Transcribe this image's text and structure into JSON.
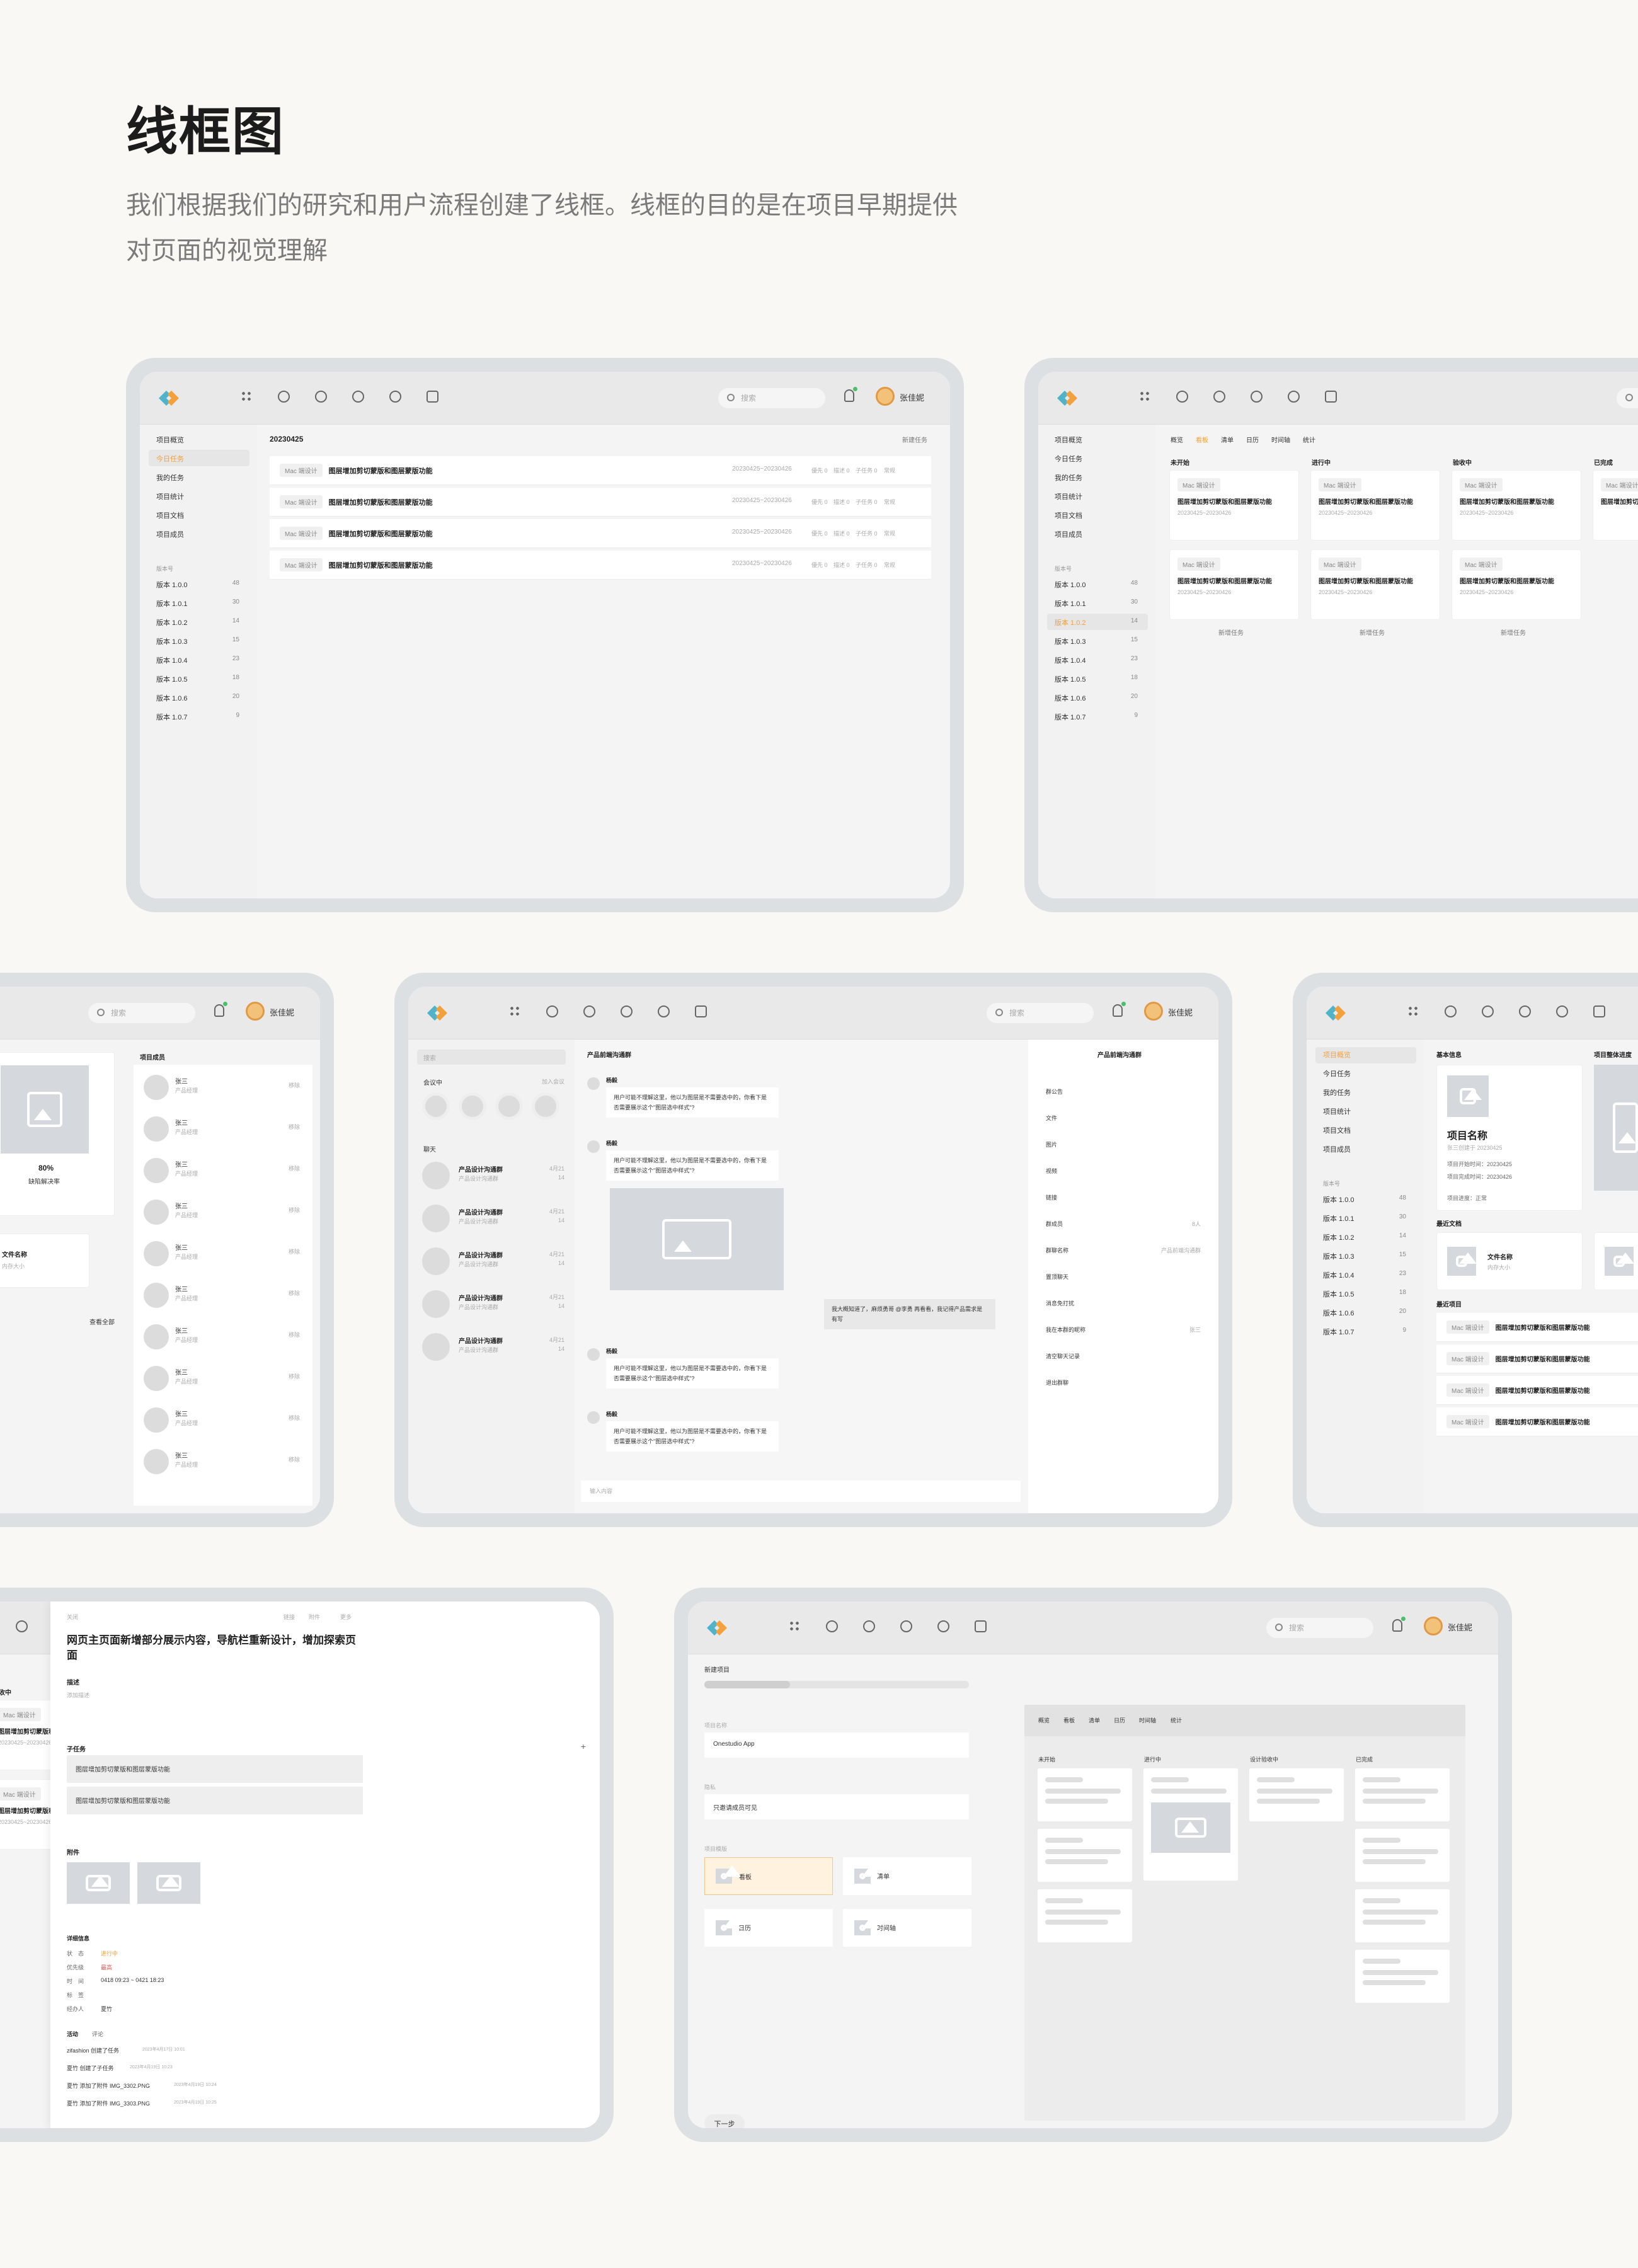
{
  "page": {
    "title": "线框图",
    "subtitle": "我们根据我们的研究和用户流程创建了线框。线框的目的是在项目早期提供对页面的视觉理解"
  },
  "common": {
    "search_placeholder": "搜索",
    "user_name": "张佳妮"
  },
  "nav": [
    "项目概览",
    "今日任务",
    "我的任务",
    "项目统计",
    "项目文档",
    "项目成员"
  ],
  "versions_label": "版本号",
  "versions": [
    {
      "name": "版本 1.0.0",
      "count": "48"
    },
    {
      "name": "版本 1.0.1",
      "count": "30"
    },
    {
      "name": "版本 1.0.2",
      "count": "14"
    },
    {
      "name": "版本 1.0.3",
      "count": "15"
    },
    {
      "name": "版本 1.0.4",
      "count": "23"
    },
    {
      "name": "版本 1.0.5",
      "count": "18"
    },
    {
      "name": "版本 1.0.6",
      "count": "20"
    },
    {
      "name": "版本 1.0.7",
      "count": "9"
    }
  ],
  "task": {
    "tag": "Mac 端设计",
    "title": "图层增加剪切蒙版和图层蒙版功能",
    "date": "20230425~20230426",
    "meta": [
      "優先 0",
      "描述 0",
      "子任务 0",
      "常规"
    ]
  },
  "screen1": {
    "date": "20230425",
    "new_task": "新建任务"
  },
  "screen2": {
    "tabs": [
      "概览",
      "看板",
      "清单",
      "日历",
      "时间轴",
      "统计"
    ],
    "columns": [
      "未开始",
      "进行中",
      "验收中",
      "已完成"
    ],
    "add": "新增任务",
    "task_date": "20230425~20230426",
    "meta": [
      "常规",
      "描述 0",
      "描述 0",
      "子任务 0"
    ]
  },
  "screen3": {
    "members_title": "项目成员",
    "member_name": "张三",
    "member_role": "产品经理",
    "member_action": "移除",
    "progress": "80%",
    "progress_label": "缺陷解决率",
    "file_name": "文件名称",
    "file_size": "内存大小",
    "view_all": "查看全部"
  },
  "screen4": {
    "search": "搜索",
    "meeting": "会议中",
    "join": "加入会议",
    "chat": "聊天",
    "group_name": "产品设计沟通群",
    "group_sub": "产品设计沟通群",
    "group_time": "4月21",
    "group_count": "14",
    "channel_title": "产品前端沟通群",
    "sender": "杨毅",
    "message": "用户可能不理解这里，他以为图层是不需要选中的，你看下是否需要展示这个\"图层选中样式\"?",
    "my_message": "我大概知道了，麻烦勇哥 @李勇 再看看，我记得产品需求是有写",
    "input": "输入内容",
    "info_title": "产品前端沟通群",
    "info_items": [
      "群公告",
      "文件",
      "图片",
      "视频",
      "链接",
      "群成员",
      "群聊名称",
      "置顶聊天",
      "消息免打扰",
      "我在本群的昵称",
      "清空聊天记录",
      "退出群聊"
    ],
    "member_count": "8人",
    "group_name_val": "产品前端沟通群",
    "nickname": "张三"
  },
  "screen5": {
    "basic_info": "基本信息",
    "progress_title": "项目整体进度",
    "project_name": "项目名称",
    "creator": "张三创建于 20230425",
    "start": "项目开始时间：20230425",
    "end": "项目完成时间：20230426",
    "status": "项目进度：正常",
    "recent_docs": "最近文档",
    "recent_items": "最近项目"
  },
  "screen6": {
    "close": "关闭",
    "links": [
      "链接",
      "附件",
      "更多"
    ],
    "title": "网页主页面新增部分展示内容，导航栏重新设计，增加探索页面",
    "desc_label": "描述",
    "desc_ph": "添加描述",
    "subtask_label": "子任务",
    "subtask": "图层增加剪切蒙版和图层蒙版功能",
    "attach_label": "附件",
    "detail_label": "详细信息",
    "status_k": "状　态",
    "status_v": "进行中",
    "prio_k": "优先级",
    "prio_v": "最高",
    "time_k": "时　间",
    "time_v": "0418 09:23 ~ 0421 18:23",
    "tag_k": "标　签",
    "owner_k": "经办人",
    "owner_v": "夏竹",
    "activity": "活动",
    "comment": "评论",
    "logs": [
      {
        "text": "zifashion 创建了任务",
        "time": "2023年4月17日 10:01"
      },
      {
        "text": "夏竹 创建了子任务",
        "time": "2023年4月19日 10:23"
      },
      {
        "text": "夏竹 添加了附件 IMG_3302.PNG",
        "time": "2023年4月19日 10:24"
      },
      {
        "text": "夏竹 添加了附件 IMG_3303.PNG",
        "time": "2023年4月19日 10:25"
      }
    ]
  },
  "screen7": {
    "back": "新建项目",
    "name_label": "项目名称",
    "name_value": "Onestudio App",
    "privacy_label": "隐私",
    "privacy_value": "只邀请成员可见",
    "template_label": "项目模版",
    "templates": [
      "看板",
      "清单",
      "日历",
      "时间轴"
    ],
    "next": "下一步",
    "preview_tabs": [
      "概览",
      "看板",
      "清单",
      "日历",
      "时间轴",
      "统计"
    ],
    "preview_cols": [
      "未开始",
      "进行中",
      "设计验收中",
      "已完成"
    ]
  }
}
